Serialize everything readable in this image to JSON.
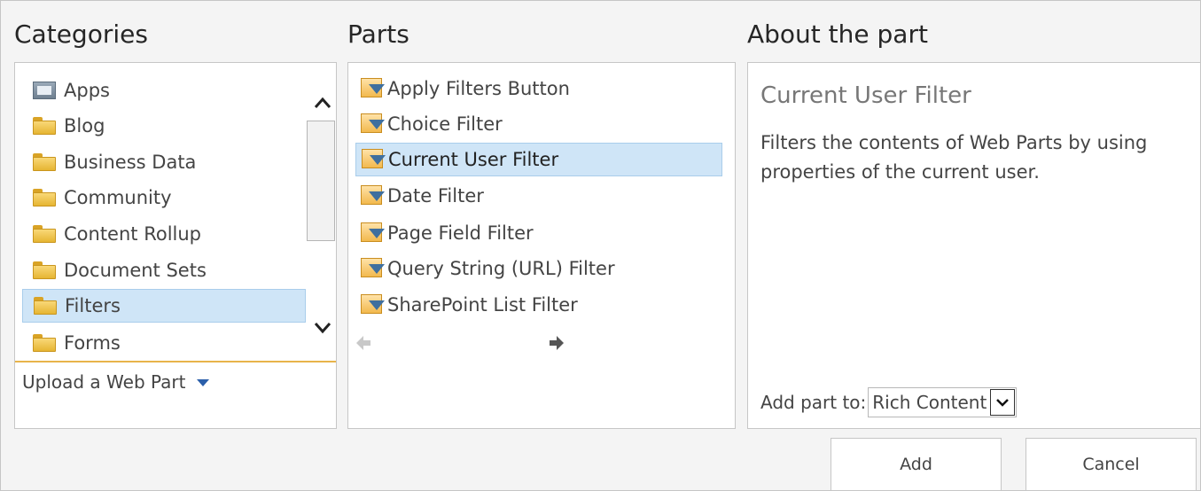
{
  "headings": {
    "categories": "Categories",
    "parts": "Parts",
    "about": "About the part"
  },
  "categories": {
    "items": [
      {
        "label": "Apps",
        "icon": "apps-icon"
      },
      {
        "label": "Blog",
        "icon": "folder-icon"
      },
      {
        "label": "Business Data",
        "icon": "folder-icon"
      },
      {
        "label": "Community",
        "icon": "folder-icon"
      },
      {
        "label": "Content Rollup",
        "icon": "folder-icon"
      },
      {
        "label": "Document Sets",
        "icon": "folder-icon"
      },
      {
        "label": "Filters",
        "icon": "folder-icon",
        "selected": true
      },
      {
        "label": "Forms",
        "icon": "folder-icon"
      }
    ],
    "upload_label": "Upload a Web Part"
  },
  "parts": {
    "items": [
      {
        "label": "Apply Filters Button"
      },
      {
        "label": "Choice Filter"
      },
      {
        "label": "Current User Filter",
        "selected": true
      },
      {
        "label": "Date Filter"
      },
      {
        "label": "Page Field Filter"
      },
      {
        "label": "Query String (URL) Filter"
      },
      {
        "label": "SharePoint List Filter"
      }
    ]
  },
  "about": {
    "title": "Current User Filter",
    "description": "Filters the contents of Web Parts by using properties of the current user.",
    "add_part_to_label": "Add part to:",
    "zone_value": "Rich Content"
  },
  "buttons": {
    "add": "Add",
    "cancel": "Cancel"
  },
  "colors": {
    "selection_bg": "#cfe5f7",
    "divider_accent": "#e8b44a",
    "dropdown_arrow": "#2b5faa"
  }
}
